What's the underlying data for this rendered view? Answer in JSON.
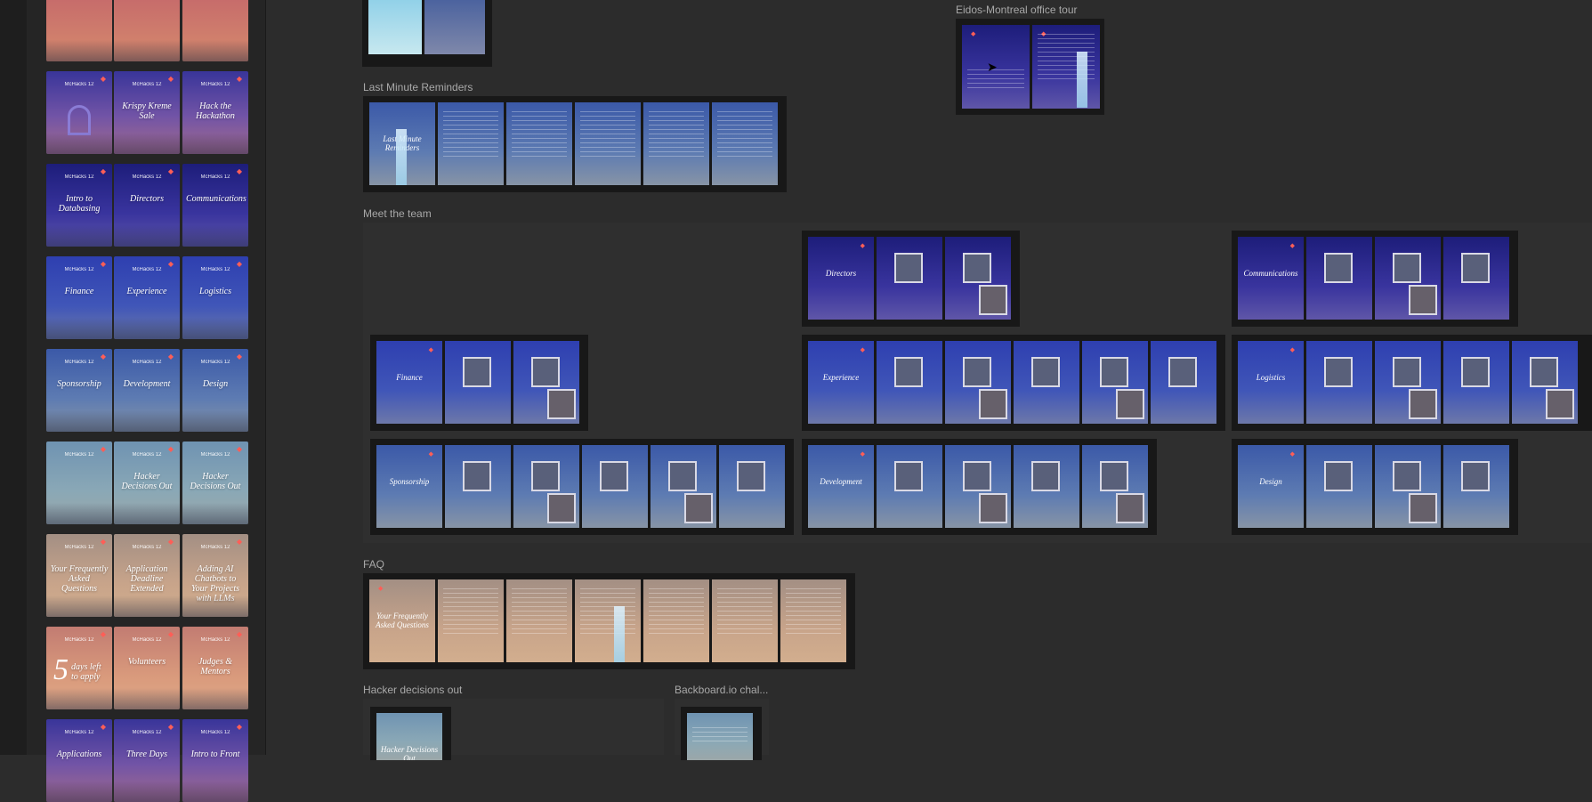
{
  "sidebar": {
    "thumbnails": [
      {
        "title": "",
        "bg": "bg-orange"
      },
      {
        "title": "",
        "bg": "bg-orange"
      },
      {
        "title": "",
        "bg": "bg-orange"
      },
      {
        "title": "",
        "bg": "bg-purple"
      },
      {
        "title": "Krispy Kreme Sale",
        "bg": "bg-purple"
      },
      {
        "title": "Hack the Hackathon",
        "bg": "bg-purple"
      },
      {
        "title": "Intro to Databasing",
        "bg": "bg-indigo"
      },
      {
        "title": "Directors",
        "bg": "bg-indigo"
      },
      {
        "title": "Communications",
        "bg": "bg-indigo"
      },
      {
        "title": "Finance",
        "bg": "bg-blue"
      },
      {
        "title": "Experience",
        "bg": "bg-blue"
      },
      {
        "title": "Logistics",
        "bg": "bg-blue"
      },
      {
        "title": "Sponsorship",
        "bg": "bg-slate"
      },
      {
        "title": "Development",
        "bg": "bg-slate"
      },
      {
        "title": "Design",
        "bg": "bg-slate"
      },
      {
        "title": "",
        "bg": "bg-teal"
      },
      {
        "title": "Hacker Decisions Out",
        "bg": "bg-teal"
      },
      {
        "title": "Hacker Decisions Out",
        "bg": "bg-teal"
      },
      {
        "title": "Your Frequently Asked Questions",
        "bg": "bg-tan"
      },
      {
        "title": "Application Deadline Extended",
        "bg": "bg-tan"
      },
      {
        "title": "Adding AI Chatbots to Your Projects with LLMs",
        "bg": "bg-tan"
      },
      {
        "title": "days left to apply",
        "bg": "bg-peach",
        "big": "5"
      },
      {
        "title": "Volunteers",
        "bg": "bg-peach"
      },
      {
        "title": "Judges & Mentors",
        "bg": "bg-peach"
      },
      {
        "title": "Applications",
        "bg": "bg-purple"
      },
      {
        "title": "Three Days",
        "bg": "bg-purple"
      },
      {
        "title": "Intro to Front",
        "bg": "bg-purple"
      }
    ],
    "logo_text": "McHacks 12"
  },
  "canvas": {
    "sections": {
      "eidos": "Eidos-Montreal office tour",
      "reminders": "Last Minute Reminders",
      "team": "Meet the team",
      "faq": "FAQ",
      "hacker": "Hacker decisions out",
      "backboard": "Backboard.io chal..."
    },
    "reminders_title": "Last Minute Reminders",
    "faq_title": "Your Frequently Asked Questions",
    "hacker_title": "Hacker Decisions Out",
    "team_frames": {
      "directors": "Directors",
      "communications": "Communications",
      "finance": "Finance",
      "experience": "Experience",
      "logistics": "Logistics",
      "sponsorship": "Sponsorship",
      "development": "Development",
      "design": "Design"
    }
  }
}
